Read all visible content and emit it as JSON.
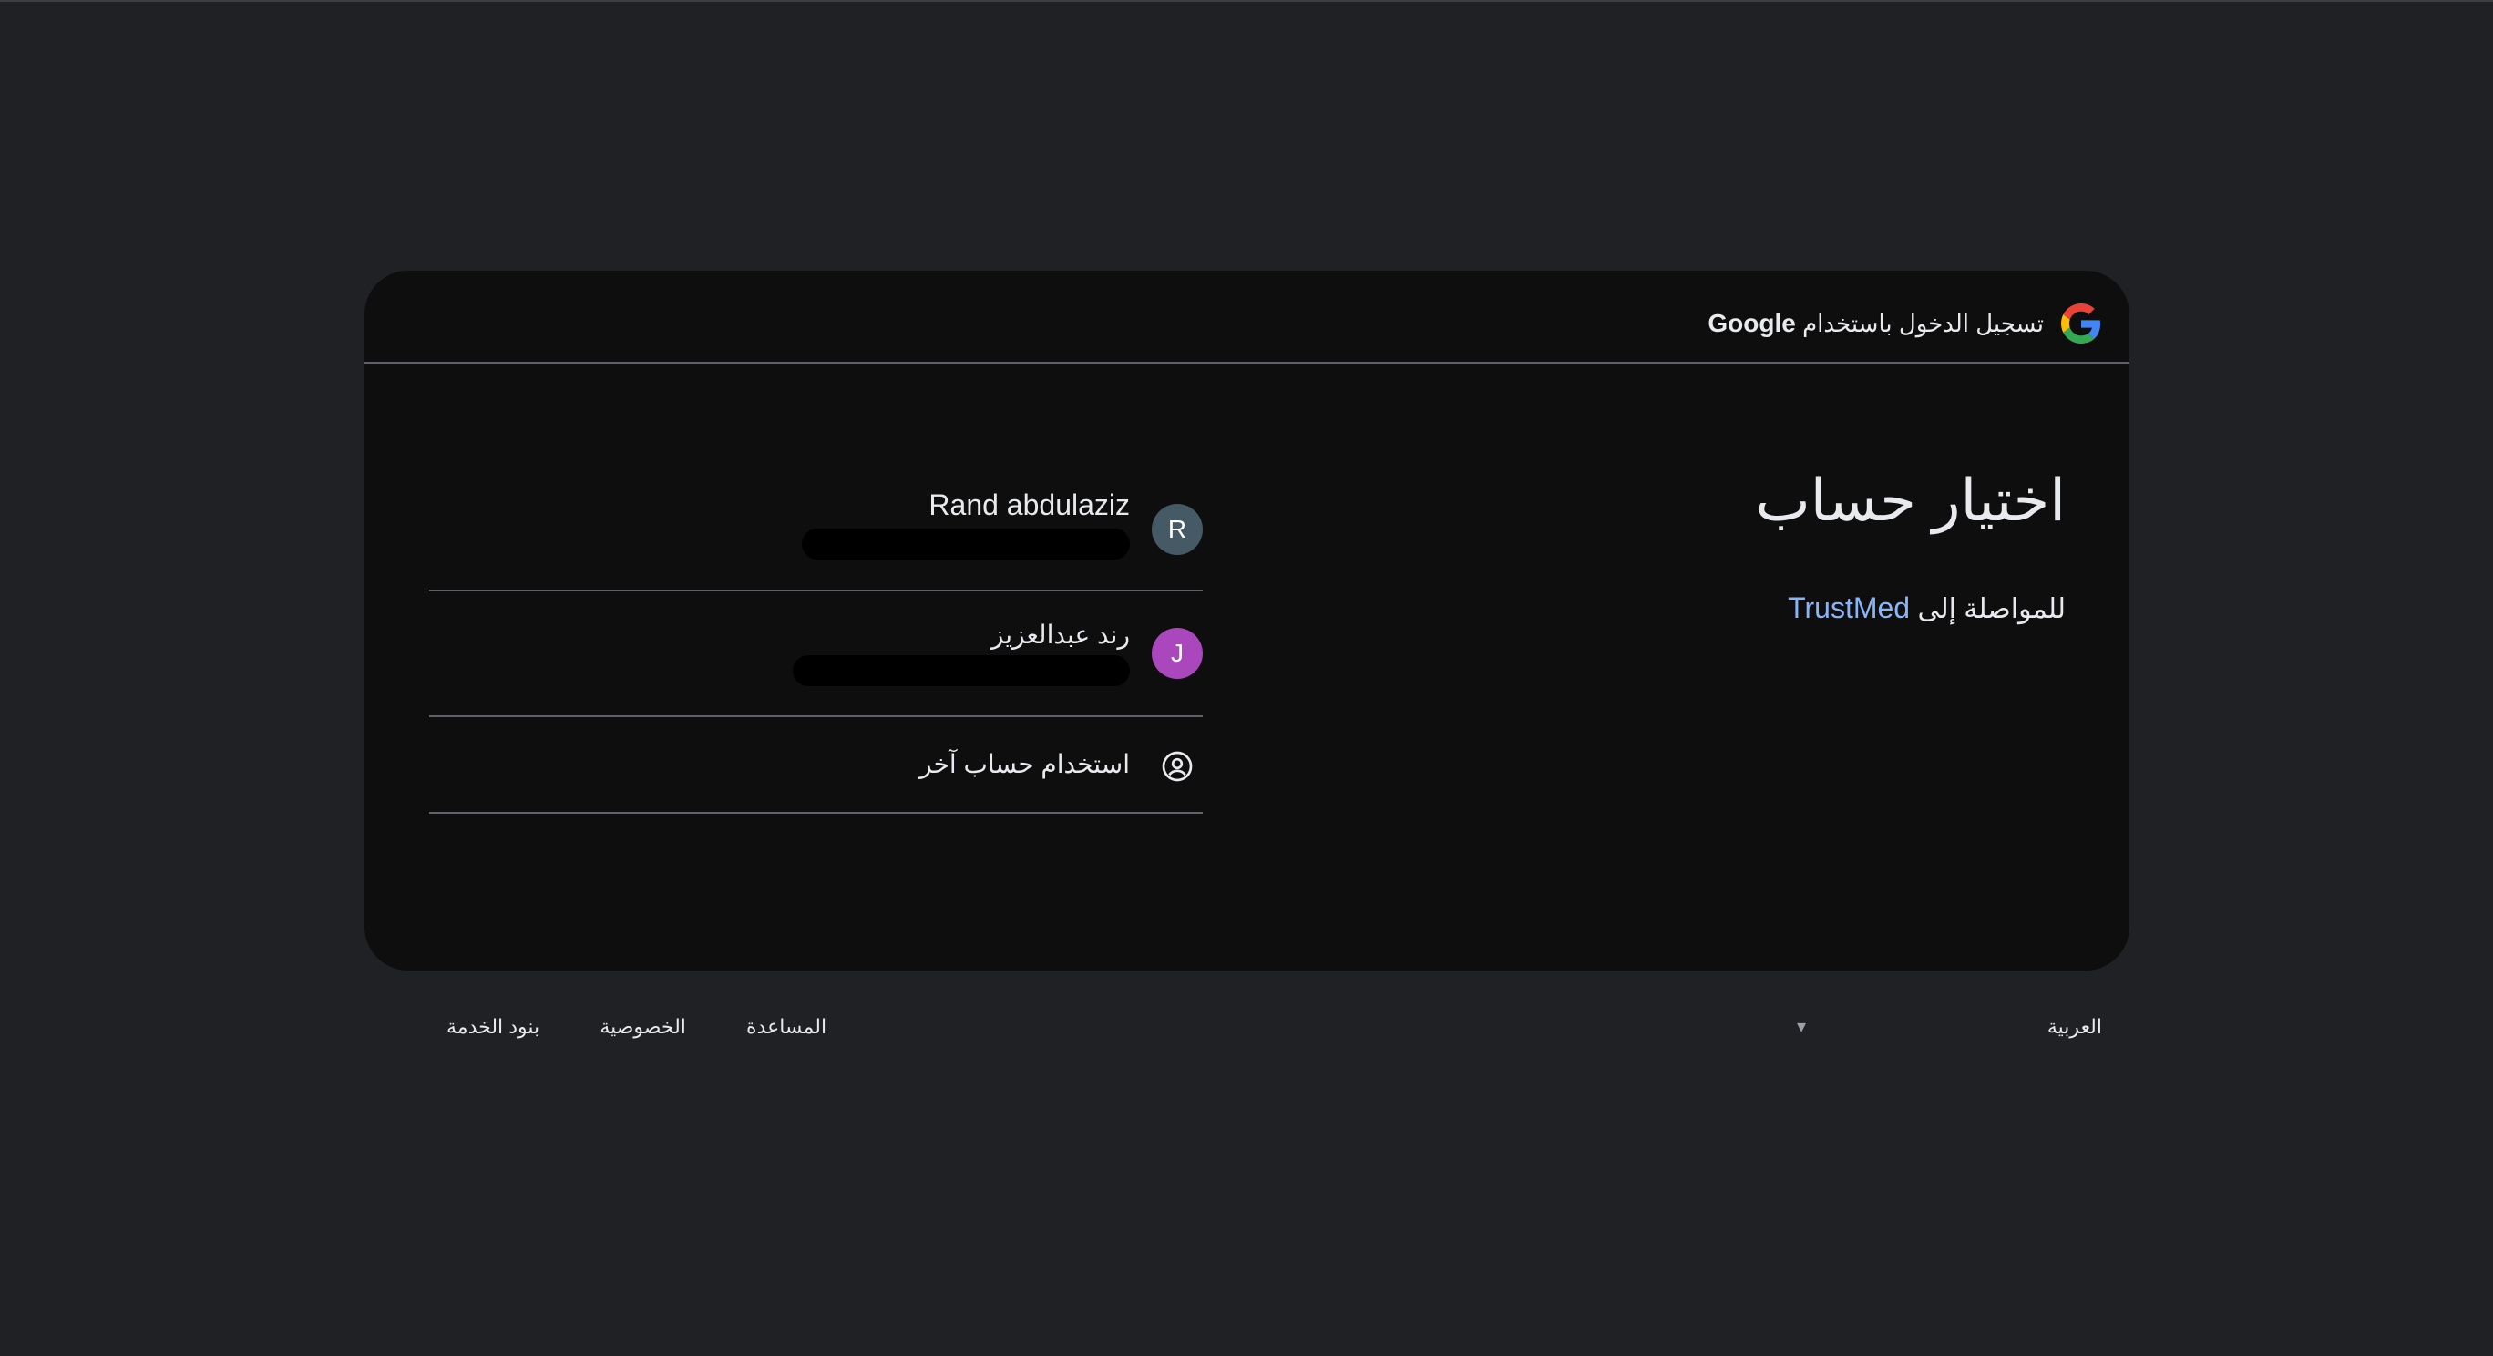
{
  "header": {
    "signin_text": "تسجيل الدخول باستخدام",
    "brand": "Google"
  },
  "main": {
    "title": "اختيار حساب",
    "subtitle_prefix": "للمواصلة إلى",
    "app_name": "TrustMed"
  },
  "accounts": [
    {
      "initial": "R",
      "name": "Rand abdulaziz",
      "avatar_color": "#455a64"
    },
    {
      "initial": "J",
      "name": "رند عبدالعزيز",
      "avatar_color": "#ab47bc"
    }
  ],
  "use_another": {
    "label": "استخدام حساب آخر",
    "icon": "account-circle-icon"
  },
  "footer": {
    "language": "العربية",
    "links": [
      "المساعدة",
      "الخصوصية",
      "بنود الخدمة"
    ]
  },
  "colors": {
    "page_background": "#202124",
    "card_background": "#0e0e0f",
    "link_blue": "#8ab4f8"
  }
}
